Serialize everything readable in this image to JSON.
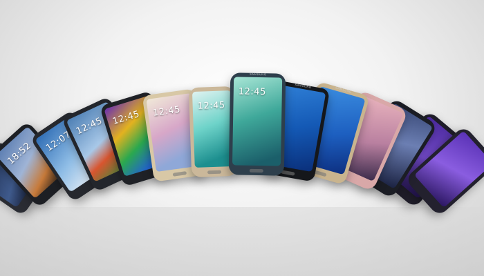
{
  "image": {
    "subject": "arc of Samsung Galaxy smartphones",
    "background": "#eeeeee"
  },
  "phones": [
    {
      "clock": "",
      "brand": "",
      "body": "#2a2c33",
      "screen": "linear-gradient(160deg,#1c2a4a,#3f5a8c 60%,#0e1224)",
      "home": false
    },
    {
      "clock": "18:52",
      "brand": "",
      "body": "#1d1f24",
      "screen": "linear-gradient(160deg,#5a7cb0,#9fb4d6 45%,#c77a3a 75%,#2a2018)",
      "home": false
    },
    {
      "clock": "12:07",
      "brand": "",
      "body": "#26282e",
      "screen": "linear-gradient(160deg,#2f6db5,#8fbde6 55%,#e8eef5)",
      "home": false
    },
    {
      "clock": "12:45",
      "brand": "",
      "body": "#23262c",
      "screen": "linear-gradient(160deg,#4d7fb4,#a8c8e8 50%,#d8552f 70%,#3b8a3a)",
      "home": false
    },
    {
      "clock": "12:45",
      "brand": "",
      "body": "#1f2126",
      "screen": "linear-gradient(150deg,#6b2fb0,#e3b21f 35%,#2aa84f 60%,#2366c9 85%)",
      "home": false
    },
    {
      "clock": "12:45",
      "brand": "",
      "body": "#d8c8a6",
      "screen": "linear-gradient(160deg,#f0e8d8,#d7a7c8 45%,#8fa8d8 80%)",
      "home": true
    },
    {
      "clock": "12:45",
      "brand": "",
      "body": "#cbb89a",
      "screen": "linear-gradient(160deg,#dff2f0,#6ed3c9 45%,#1d8f8f 85%)",
      "home": true
    },
    {
      "clock": "12:45",
      "brand": "SAMSUNG",
      "body": "#2e3f4c",
      "screen": "linear-gradient(160deg,#a8e6d6,#3fa89a 45%,#1b5f6a 90%)",
      "home": true
    },
    {
      "clock": "",
      "brand": "SAMSUNG",
      "body": "#15171b",
      "screen": "linear-gradient(160deg,#2f7fd6,#1459b5 50%,#0a2f7a)",
      "home": true
    },
    {
      "clock": "",
      "brand": "SAMSUNG",
      "body": "#c9b48e",
      "screen": "linear-gradient(160deg,#3b8de0,#1d5fc0 55%,#0d2f80)",
      "home": true
    },
    {
      "clock": "",
      "brand": "",
      "body": "#d9a8a8",
      "screen": "linear-gradient(160deg,#e9b3bd,#b980a0 55%,#3a2a4a)",
      "home": false
    },
    {
      "clock": "",
      "brand": "",
      "body": "#1b1d24",
      "screen": "linear-gradient(160deg,#3a4a78,#6c7fb3 45%,#1a2140)",
      "home": false
    },
    {
      "clock": "",
      "brand": "",
      "body": "#1f1d29",
      "screen": "linear-gradient(160deg,#4b2a9c,#7a4fd6 50%,#231450)",
      "home": false
    },
    {
      "clock": "",
      "brand": "",
      "body": "#23212e",
      "screen": "linear-gradient(160deg,#5a32b6,#8a5de0 50%,#2a1660)",
      "home": false
    }
  ]
}
